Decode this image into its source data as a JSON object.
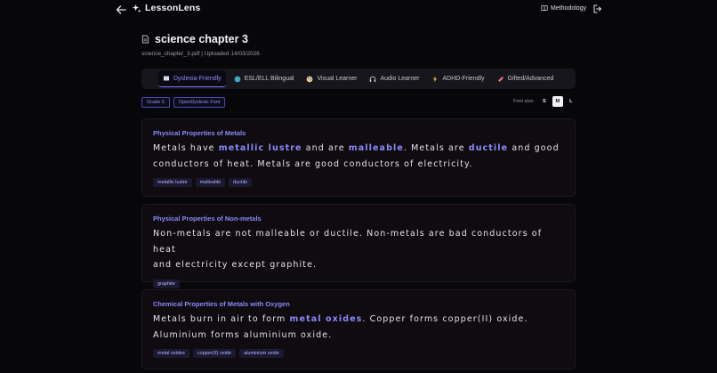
{
  "brand": {
    "name": "LessonLens"
  },
  "nav": {
    "methodology_label": "Methodology"
  },
  "document": {
    "title": "science chapter 3",
    "subtitle": "science_chapter_3.pdf | Uploaded 14/03/2026"
  },
  "tabs": [
    {
      "label": "Dyslexia-Friendly",
      "icon": "book-icon",
      "active": true
    },
    {
      "label": "ESL/ELL Bilingual",
      "icon": "globe-icon"
    },
    {
      "label": "Visual Learner",
      "icon": "palette-icon"
    },
    {
      "label": "Audio Learner",
      "icon": "headphones-icon"
    },
    {
      "label": "ADHD-Friendly",
      "icon": "bolt-icon"
    },
    {
      "label": "Gifted/Advanced",
      "icon": "rocket-icon"
    }
  ],
  "chips": [
    "Grade 5",
    "OpenDyslexic Font"
  ],
  "font_size": {
    "label": "Font size:",
    "options": [
      "S",
      "M",
      "L"
    ],
    "selected": "M"
  },
  "sections": [
    {
      "title": "Physical Properties of Metals",
      "line1": [
        {
          "t": "Metals have "
        },
        {
          "t": "metallic lustre",
          "h": true
        },
        {
          "t": " and are "
        },
        {
          "t": "malleable",
          "h": true
        },
        {
          "t": ". Metals are "
        },
        {
          "t": "ductile",
          "h": true
        },
        {
          "t": " and good"
        }
      ],
      "line2": [
        {
          "t": "conductors of heat. Metals are good conductors of electricity."
        }
      ],
      "tags": [
        "metallic lustre",
        "malleable",
        "ductile"
      ]
    },
    {
      "title": "Physical Properties of Non-metals",
      "line1": [
        {
          "t": "Non-metals are not malleable or ductile. Non-metals are bad conductors of heat"
        }
      ],
      "line2": [
        {
          "t": "and electricity except graphite."
        }
      ],
      "tags": [
        "graphite"
      ]
    },
    {
      "title": "Chemical Properties of Metals with Oxygen",
      "line1": [
        {
          "t": "Metals burn in air to form "
        },
        {
          "t": "metal oxides",
          "h": true
        },
        {
          "t": ". Copper forms copper(II) oxide."
        }
      ],
      "line2": [
        {
          "t": "Aluminium forms aluminium oxide."
        }
      ],
      "tags": [
        "metal oxides",
        "copper(II) oxide",
        "aluminium oxide"
      ]
    }
  ],
  "colors": {
    "accent": "#8c89ff",
    "background": "#07070a",
    "card": "#0f0b0e"
  }
}
